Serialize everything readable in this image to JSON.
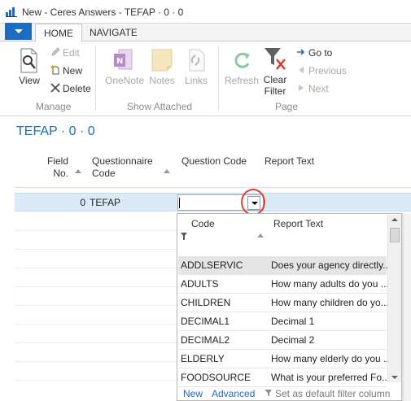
{
  "window": {
    "title": "New - Ceres Answers - TEFAP · 0 · 0"
  },
  "ribbon": {
    "tabs": [
      {
        "label": "HOME"
      },
      {
        "label": "NAVIGATE"
      }
    ],
    "groups": {
      "manage": {
        "label": "Manage",
        "view": "View",
        "edit": "Edit",
        "new": "New",
        "delete": "Delete"
      },
      "show_attached": {
        "label": "Show Attached",
        "onenote": "OneNote",
        "notes": "Notes",
        "links": "Links"
      },
      "page": {
        "label": "Page",
        "refresh": "Refresh",
        "clear_filter_line1": "Clear",
        "clear_filter_line2": "Filter",
        "goto": "Go to",
        "previous": "Previous",
        "next": "Next"
      }
    }
  },
  "page": {
    "title": "TEFAP · 0 · 0"
  },
  "list": {
    "columns": {
      "field_no_line1": "Field",
      "field_no_line2": "No.",
      "questionnaire_line1": "Questionnaire",
      "questionnaire_line2": "Code",
      "question_code": "Question Code",
      "report_text": "Report Text"
    },
    "row": {
      "field_no": "0",
      "questionnaire_code": "TEFAP",
      "question_code": ""
    }
  },
  "lookup": {
    "columns": {
      "code": "Code",
      "report_text": "Report Text"
    },
    "rows": [
      {
        "code": "ADDLSERVIC",
        "text": "Does your agency directly..."
      },
      {
        "code": "ADULTS",
        "text": "How many adults do you ..."
      },
      {
        "code": "CHILDREN",
        "text": "How many children do yo..."
      },
      {
        "code": "DECIMAL1",
        "text": "Decimal 1"
      },
      {
        "code": "DECIMAL2",
        "text": "Decimal 2"
      },
      {
        "code": "ELDERLY",
        "text": "How many elderly do you ..."
      },
      {
        "code": "FOODSOURCE",
        "text": "What is your preferred Fo..."
      }
    ],
    "footer": {
      "new": "New",
      "advanced": "Advanced",
      "default_filter": "Set as default filter column"
    }
  },
  "colors": {
    "accent": "#1d6cc1",
    "selection": "#dce9f6",
    "highlight_ring": "#e23a3a"
  }
}
